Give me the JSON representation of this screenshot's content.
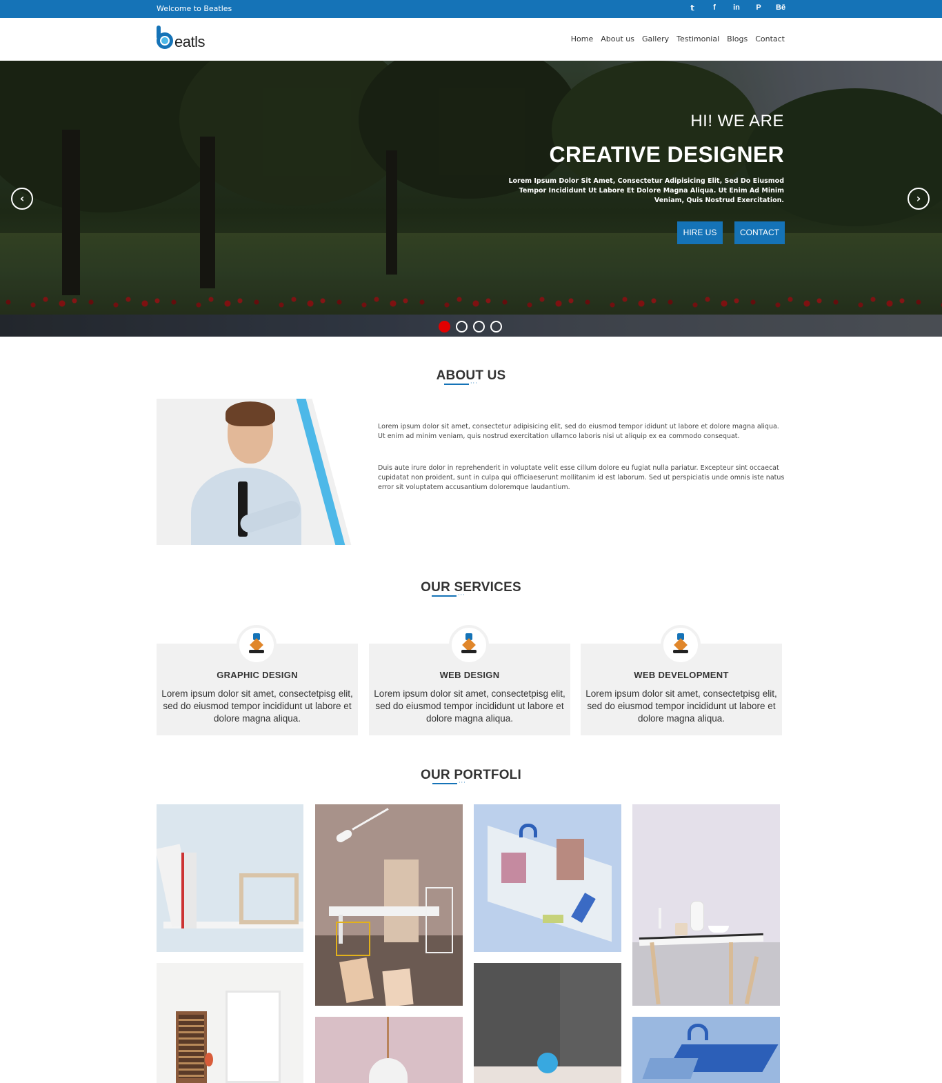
{
  "topbar": {
    "welcome": "Welcome to Beatles",
    "social": [
      {
        "icon": "twitter-icon",
        "glyph": "𝕥"
      },
      {
        "icon": "facebook-icon",
        "glyph": "f"
      },
      {
        "icon": "linkedin-icon",
        "glyph": "in"
      },
      {
        "icon": "pinterest-icon",
        "glyph": "P"
      },
      {
        "icon": "behance-icon",
        "glyph": "Bē"
      }
    ]
  },
  "header": {
    "logo_text": "eatls",
    "nav": [
      "Home",
      "About us",
      "Gallery",
      "Testimonial",
      "Blogs",
      "Contact"
    ]
  },
  "hero": {
    "subtitle": "HI! WE ARE",
    "title": "CREATIVE DESIGNER",
    "description": "Lorem Ipsum Dolor Sit Amet, Consectetur Adipisicing Elit, Sed Do Eiusmod Tempor Incididunt Ut Labore Et Dolore Magna Aliqua. Ut Enim Ad Minim Veniam, Quis Nostrud Exercitation.",
    "hire_button": "HIRE US",
    "contact_button": "CONTACT",
    "prev_arrow": "‹",
    "next_arrow": "›",
    "slide_count": 4,
    "active_slide": 1
  },
  "about": {
    "heading": "ABOUT US",
    "paragraph1": "Lorem ipsum dolor sit amet, consectetur adipisicing elit, sed do eiusmod tempor ididunt ut labore et dolore magna aliqua. Ut enim ad minim veniam, quis nostrud exercitation ullamco laboris nisi ut aliquip ex ea commodo consequat.",
    "paragraph2": "Duis aute irure dolor in reprehenderit in voluptate velit esse cillum dolore eu fugiat nulla pariatur. Excepteur sint occaecat cupidatat non proident, sunt in culpa qui officiaeserunt mollitanim id est laborum. Sed ut perspiciatis unde omnis iste natus error sit voluptatem accusantium doloremque laudantium."
  },
  "services": {
    "heading": "OUR SERVICES",
    "items": [
      {
        "title": "GRAPHIC DESIGN",
        "desc": "Lorem ipsum dolor sit amet, consectetpisg elit, sed do eiusmod tempor incididunt ut labore et dolore magna aliqua.",
        "icon": "pen-tool-icon"
      },
      {
        "title": "WEB DESIGN",
        "desc": "Lorem ipsum dolor sit amet, consectetpisg elit, sed do eiusmod tempor incididunt ut labore et dolore magna aliqua.",
        "icon": "pen-tool-icon"
      },
      {
        "title": "WEB DEVELOPMENT",
        "desc": "Lorem ipsum dolor sit amet, consectetpisg elit, sed do eiusmod tempor incididunt ut labore et dolore magna aliqua.",
        "icon": "pen-tool-icon"
      }
    ]
  },
  "portfolio": {
    "heading": "OUR PORTFOLI"
  },
  "colors": {
    "brand": "#1573b7",
    "accent": "#4db8e8",
    "active_dot": "#e30000"
  }
}
